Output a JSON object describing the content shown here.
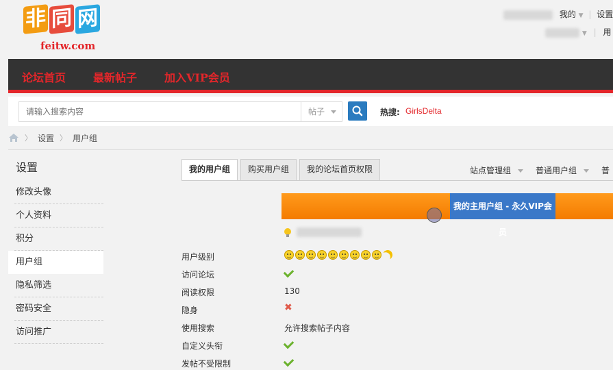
{
  "logo": {
    "chars": [
      "非",
      "同",
      "网"
    ],
    "colors": [
      "#f39c12",
      "#e74c3c",
      "#2aa7e0"
    ],
    "url": "feitw.com"
  },
  "topbar": {
    "my": "我的",
    "settings": "设置",
    "user": "用"
  },
  "nav": {
    "items": [
      "论坛首页",
      "最新帖子",
      "加入VIP会员"
    ]
  },
  "search": {
    "placeholder": "请输入搜索内容",
    "scope": "帖子",
    "hot_label": "热搜:",
    "hot_link": "GirlsDelta"
  },
  "breadcrumb": {
    "items": [
      "设置",
      "用户组"
    ]
  },
  "sidebar": {
    "title": "设置",
    "items": [
      "修改头像",
      "个人资料",
      "积分",
      "用户组",
      "隐私筛选",
      "密码安全",
      "访问推广"
    ],
    "active": "用户组"
  },
  "tabs": {
    "items": [
      "我的用户组",
      "购买用户组",
      "我的论坛首页权限"
    ],
    "active": "我的用户组"
  },
  "right_tabs": [
    "站点管理组",
    "普通用户组",
    "普"
  ],
  "group_header": {
    "title": "我的主用户组 - 永久VIP会员"
  },
  "properties": [
    {
      "label": "用户级别",
      "kind": "stars",
      "value": "9 smileys + 1 moon"
    },
    {
      "label": "访问论坛",
      "kind": "check"
    },
    {
      "label": "阅读权限",
      "kind": "text",
      "value": "130"
    },
    {
      "label": "隐身",
      "kind": "cross"
    },
    {
      "label": "使用搜索",
      "kind": "text",
      "value": "允许搜索帖子内容"
    },
    {
      "label": "自定义头衔",
      "kind": "check"
    },
    {
      "label": "发帖不受限制",
      "kind": "check"
    }
  ],
  "colors": {
    "brand_red": "#e3262a",
    "nav_bg": "#333333",
    "orange": "#f47b00",
    "blue": "#3a78c8",
    "check": "#6cb22e",
    "cross": "#e05a4a"
  }
}
